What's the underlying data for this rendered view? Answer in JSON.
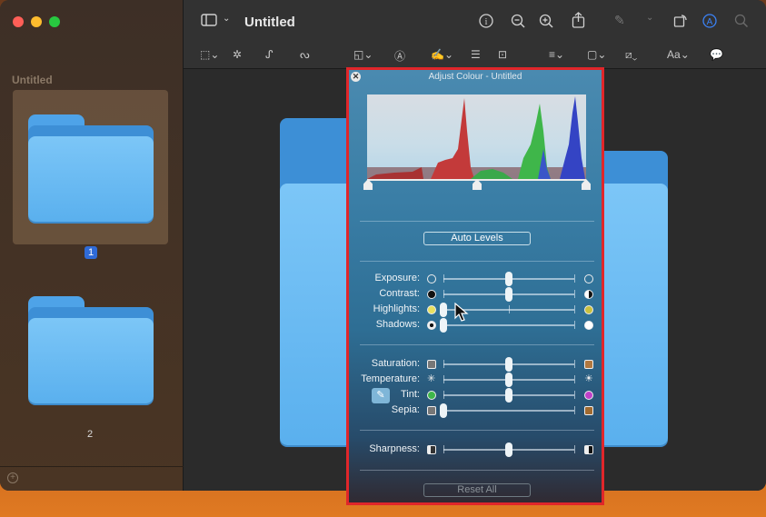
{
  "window": {
    "title": "Untitled"
  },
  "sidebar": {
    "title": "Untitled",
    "pages": [
      {
        "number": "1",
        "selected": true
      },
      {
        "number": "2",
        "selected": false
      }
    ],
    "add_icon": "plus-circle-icon"
  },
  "toolbar": {
    "row1_icons": [
      "sidebar-toggle-icon",
      "chevron-down-icon",
      "info-icon",
      "zoom-out-icon",
      "zoom-in-icon",
      "share-icon",
      "highlight-pen-icon",
      "rotate-icon",
      "markup-icon",
      "search-icon"
    ],
    "row2_icons": [
      "rect-select-icon",
      "instant-alpha-icon",
      "sketch-icon",
      "draw-icon",
      "shapes-icon",
      "text-box-icon",
      "sign-icon",
      "adjust-color-icon",
      "adjust-size-icon",
      "line-style-icon",
      "border-color-icon",
      "fill-color-icon",
      "text-style-icon",
      "notes-icon"
    ],
    "text_style_label": "Aa"
  },
  "panel": {
    "title": "Adjust Colour - Untitled",
    "close_glyph": "✕",
    "auto_levels_label": "Auto Levels",
    "reset_label": "Reset All",
    "levels_markers": [
      0,
      0.5,
      1
    ],
    "sliders": [
      {
        "label": "Exposure:",
        "value": 0.5
      },
      {
        "label": "Contrast:",
        "value": 0.5
      },
      {
        "label": "Highlights:",
        "value": 0.0
      },
      {
        "label": "Shadows:",
        "value": 0.0
      },
      {
        "label": "Saturation:",
        "value": 0.5
      },
      {
        "label": "Temperature:",
        "value": 0.5
      },
      {
        "label": "Tint:",
        "value": 0.5
      },
      {
        "label": "Sepia:",
        "value": 0.0
      },
      {
        "label": "Sharpness:",
        "value": 0.5
      }
    ]
  },
  "colors": {
    "highlight_border": "#e0262a",
    "folder": "#5ab0ee",
    "selection": "#2f6bd8"
  }
}
